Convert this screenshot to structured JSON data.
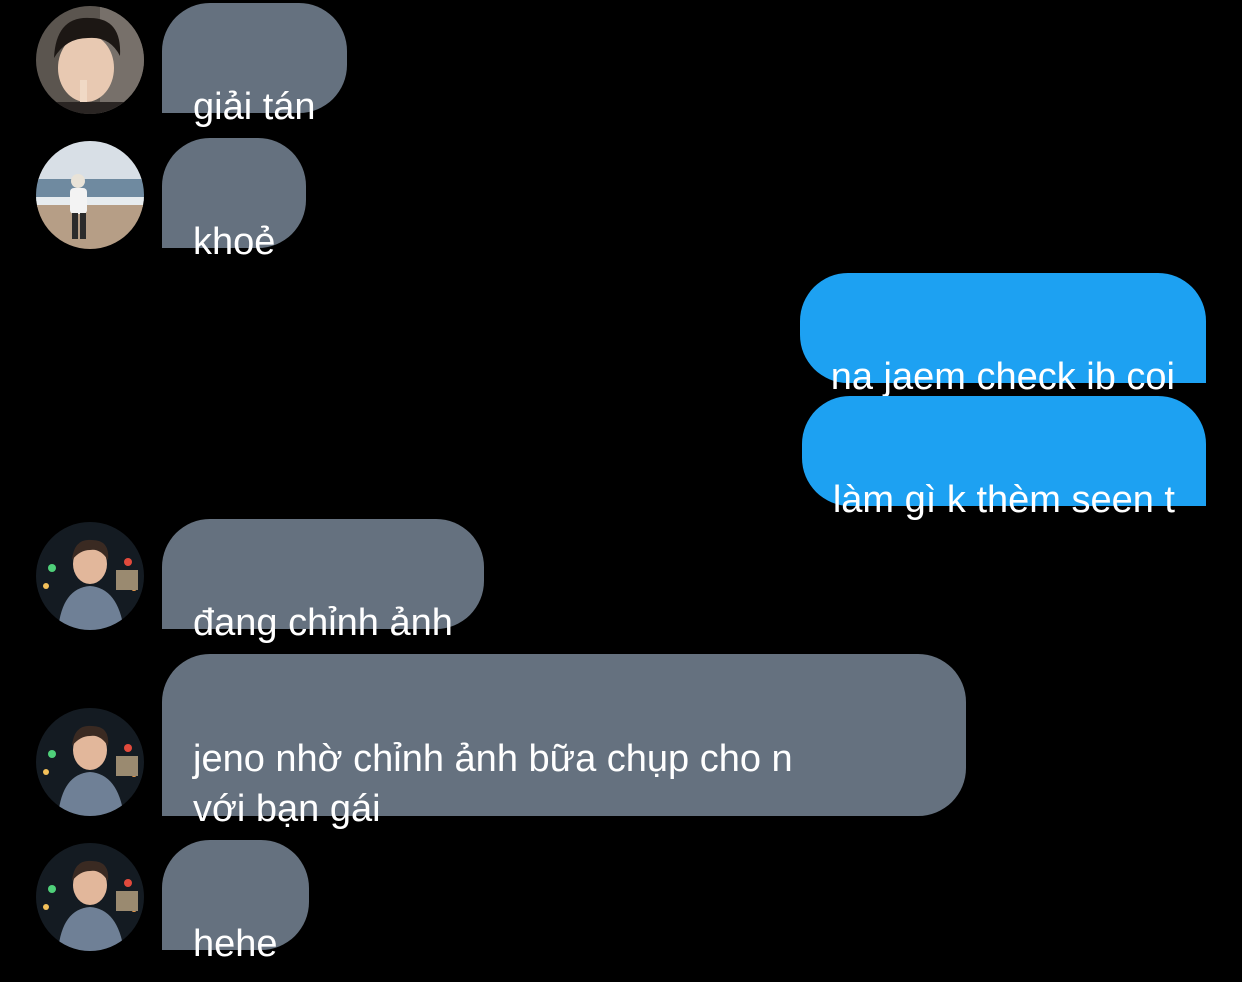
{
  "conversation": {
    "background_color": "#000000",
    "incoming_bubble_color": "#65717f",
    "outgoing_bubble_color": "#1da1f2",
    "messages": [
      {
        "direction": "incoming",
        "text": "giải tán",
        "avatar": "avatar-photo-dark-hair-icon"
      },
      {
        "direction": "incoming",
        "text": "khoẻ",
        "avatar": "avatar-photo-beach-icon"
      },
      {
        "direction": "outgoing",
        "text": "na jaem check ib coi"
      },
      {
        "direction": "outgoing",
        "text": "làm gì k thèm seen t"
      },
      {
        "direction": "incoming",
        "text": "đang chỉnh ảnh",
        "avatar": "avatar-photo-night-city-icon"
      },
      {
        "direction": "incoming",
        "text": "jeno nhờ chỉnh ảnh bữa chụp cho n\nvới bạn gái",
        "avatar": "avatar-photo-night-city-icon"
      },
      {
        "direction": "incoming",
        "text": "hehe",
        "avatar": "avatar-photo-night-city-icon"
      }
    ]
  }
}
